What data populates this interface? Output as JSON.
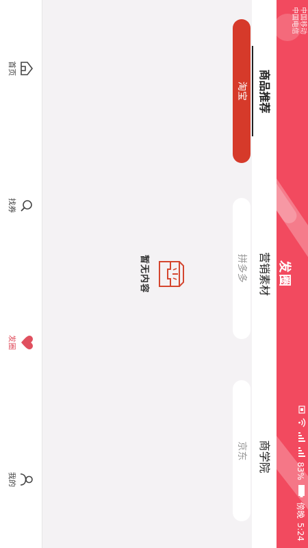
{
  "status_bar": {
    "carrier_lines": [
      "中国移动",
      "中国电信"
    ],
    "time": "5:24",
    "period": "傍晚",
    "battery": "83%"
  },
  "header": {
    "title": "发圈"
  },
  "tabs": [
    {
      "label": "商品推荐",
      "active": true
    },
    {
      "label": "营销素材",
      "active": false
    },
    {
      "label": "商学院",
      "active": false
    }
  ],
  "platforms": [
    {
      "label": "淘宝",
      "active": true
    },
    {
      "label": "拼多多",
      "active": false
    },
    {
      "label": "京东",
      "active": false
    }
  ],
  "empty_state": {
    "text": "暂无内容",
    "icon": "empty-box-icon"
  },
  "bottom_nav": [
    {
      "label": "首页",
      "icon": "home-icon",
      "active": false
    },
    {
      "label": "找券",
      "icon": "search-icon",
      "active": false
    },
    {
      "label": "发圈",
      "icon": "heart-icon",
      "active": true
    },
    {
      "label": "我的",
      "icon": "user-icon",
      "active": false
    }
  ],
  "colors": {
    "header_bg": "#f24a5f",
    "active_pill": "#d63a2a",
    "active_nav": "#e0505f",
    "page_bg": "#f4f2f4"
  },
  "system_nav": [
    "back-icon",
    "home-circle-icon",
    "recents-icon"
  ]
}
